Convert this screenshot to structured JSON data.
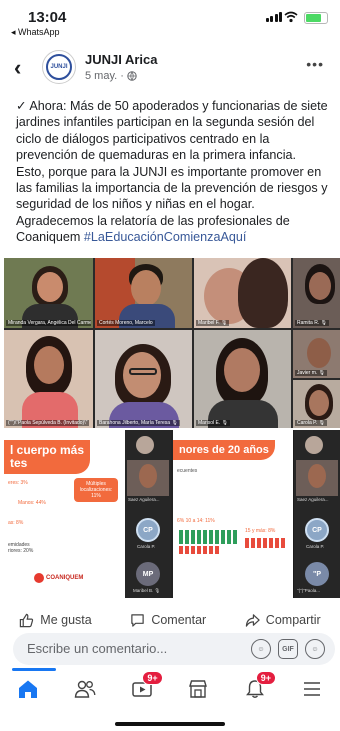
{
  "status_bar": {
    "time": "13:04",
    "back_app": "◂ WhatsApp"
  },
  "post": {
    "page_name": "JUNJI Arica",
    "logo_text": "JUNJI",
    "date": "5 may.",
    "check": "✓",
    "line1": " Ahora: Más de 50 apoderados y funcionarias de siete jardines infantiles participan en la segunda sesión del ciclo de diálogos participativos centrado en la prevención de  quemaduras en la primera infancia.",
    "line2": "Esto, porque para la JUNJI es importante promover en las familias la importancia de la prevención de riesgos y seguridad de los niños y niñas en el hogar.",
    "line3": "Agradecemos la relatoría de las profesionales de Coaniquem ",
    "hashtag": "#LaEducaciónComienzaAquí"
  },
  "video_call": {
    "tiles": [
      "Miranda Vergara, Angélica Del Carmen",
      "Cortés Moreno, Marcelo",
      "Maribel F. 🎙",
      "Ramita R. 🎙",
      "(\"\")\\\"Paola Sepúlveda B. (Invitado)\\\"",
      "Barahona Jilberto, María Teresa 🎙",
      "Marisol E. 🎙",
      "Javier m. 🎙",
      "Carola P. 🎙"
    ]
  },
  "slides": {
    "left": {
      "banner": "l cuerpo más\ntes",
      "stat1": "eres: 3%",
      "stat2": "Manos: 44%",
      "stat3": "Múltiples localizaciones: 11%",
      "stat4": "as: 8%",
      "stat5": "emidades\nriores: 20%",
      "brand": "COANIQUEM",
      "side": [
        "Saez Aguilera...",
        "Carola P.",
        "Maribel B. 🎙"
      ],
      "avatars": [
        "CP",
        "MP"
      ]
    },
    "right": {
      "banner": "nores de 20 años",
      "sub": "ecuentes",
      "stat1": "6%  10 a 14: 11%",
      "stat2": "15 y más: 8%",
      "side": [
        "Saez Aguilera...",
        "Carola P.",
        "\"(\")\"Paola..."
      ],
      "avatars": [
        "CP",
        "\"P"
      ]
    }
  },
  "actions": {
    "like": "Me gusta",
    "comment": "Comentar",
    "share": "Compartir"
  },
  "comment_box": {
    "placeholder": "Escribe un comentario...",
    "gif": "GIF"
  },
  "tabbar": {
    "video_badge": "9+",
    "notif_badge": "9+"
  },
  "colors": {
    "accent": "#1877f2",
    "badge": "#e41e3f",
    "coaniquem": "#f26a3d"
  }
}
